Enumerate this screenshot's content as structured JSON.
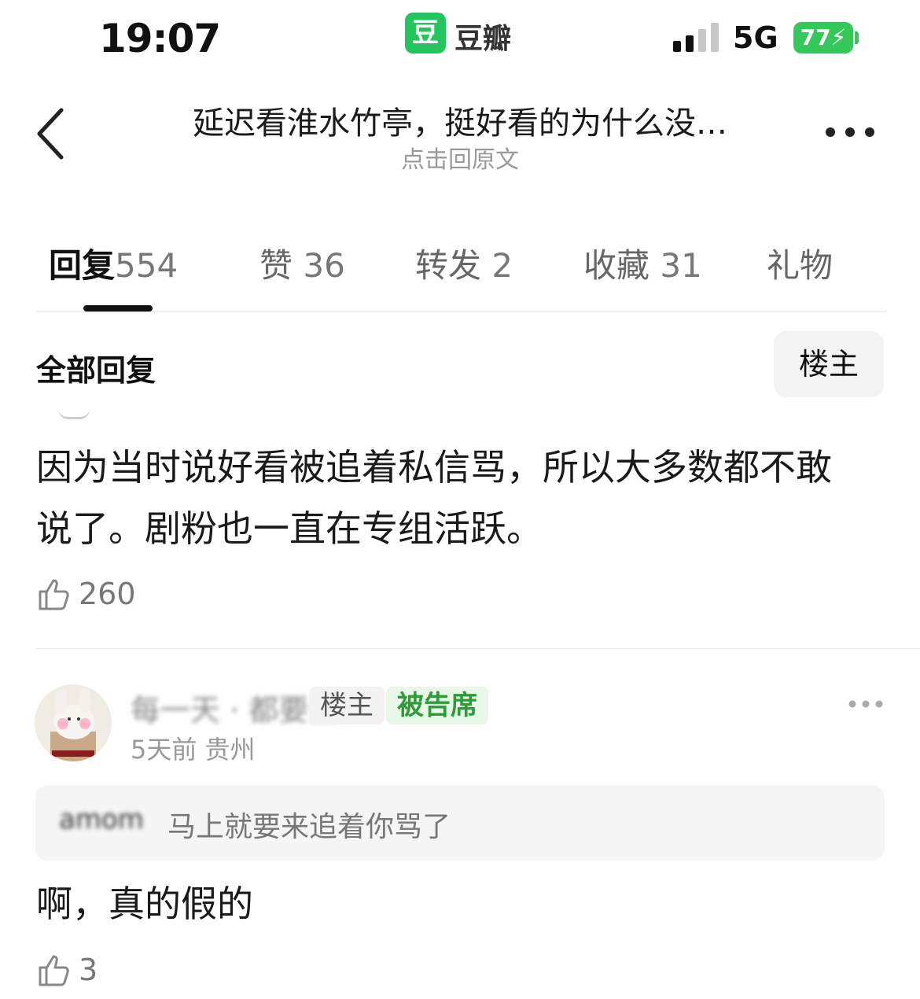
{
  "status_bar": {
    "time": "19:07",
    "app_badge": "豆",
    "app_name": "豆瓣",
    "network": "5G",
    "battery": "77"
  },
  "nav": {
    "title": "延迟看淮水竹亭，挺好看的为什么没…",
    "subtitle": "点击回原文"
  },
  "tabs": [
    {
      "label": "回复",
      "count": "554"
    },
    {
      "label": "赞",
      "count": "36"
    },
    {
      "label": "转发",
      "count": "2"
    },
    {
      "label": "收藏",
      "count": "31"
    },
    {
      "label": "礼物",
      "count": ""
    }
  ],
  "filter": {
    "all_label": "全部回复",
    "op_button": "楼主"
  },
  "comment1": {
    "text_line1": "因为当时说好看被追着私信骂，所以大多数都不敢",
    "text_line2": "说了。剧粉也一直在专组活跃。",
    "likes": "260"
  },
  "comment2": {
    "username": "每一天 · 都要全",
    "badge_op": "楼主",
    "badge_court": "被告席",
    "meta": "5天前 贵州",
    "quote_name": "amom",
    "quote_text": "马上就要来追着你骂了",
    "text": "啊，真的假的",
    "likes": "3"
  },
  "colors": {
    "accent_green": "#22c55e",
    "battery_green": "#34c759",
    "court_badge_text": "#2e9b3a"
  }
}
